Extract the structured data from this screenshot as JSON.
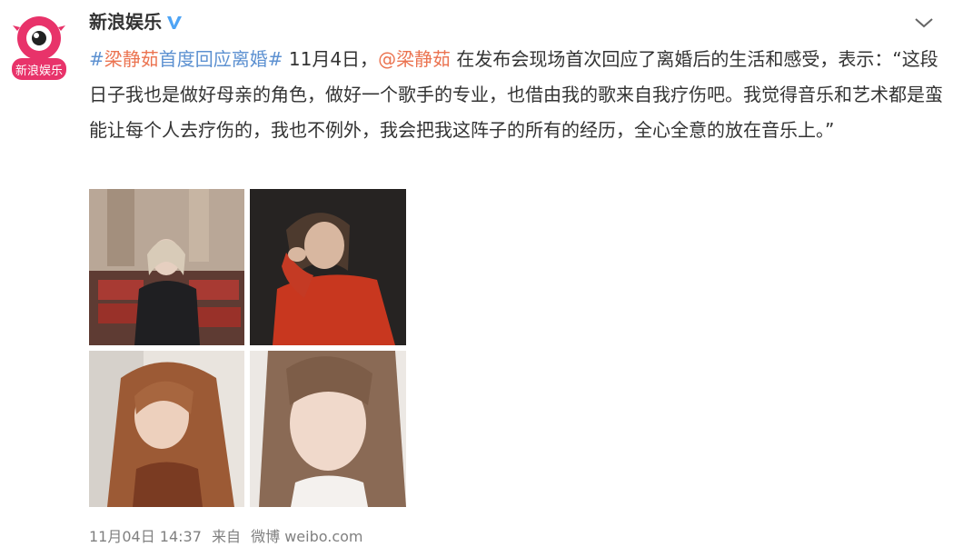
{
  "account": {
    "name": "新浪娱乐",
    "avatar_text": "新浪娱乐",
    "verified_icon": "verified-v-icon"
  },
  "post": {
    "hashtag_open": "#",
    "hashtag_person": "梁静茹",
    "hashtag_rest": "首度回应离婚#",
    "date_text": " 11月4日，",
    "mention": "@梁静茹",
    "body": " 在发布会现场首次回应了离婚后的生活和感受，表示：“这段日子我也是做好母亲的角色，做好一个歌手的专业，也借由我的歌来自我疗伤吧。我觉得音乐和艺术都是蛮能让每个人去疗伤的，我也不例外，我会把我这阵子的所有的经历，全心全意的放在音乐上。”"
  },
  "photos": [
    {
      "desc": "photo-1"
    },
    {
      "desc": "photo-2"
    },
    {
      "desc": "photo-3"
    },
    {
      "desc": "photo-4"
    }
  ],
  "meta": {
    "time": "11月04日 14:37",
    "from_label": "来自",
    "source": "微博 weibo.com"
  },
  "colors": {
    "link": "#eb7350",
    "hashtag": "#5d91d1",
    "verified": "#4ea4f5"
  }
}
